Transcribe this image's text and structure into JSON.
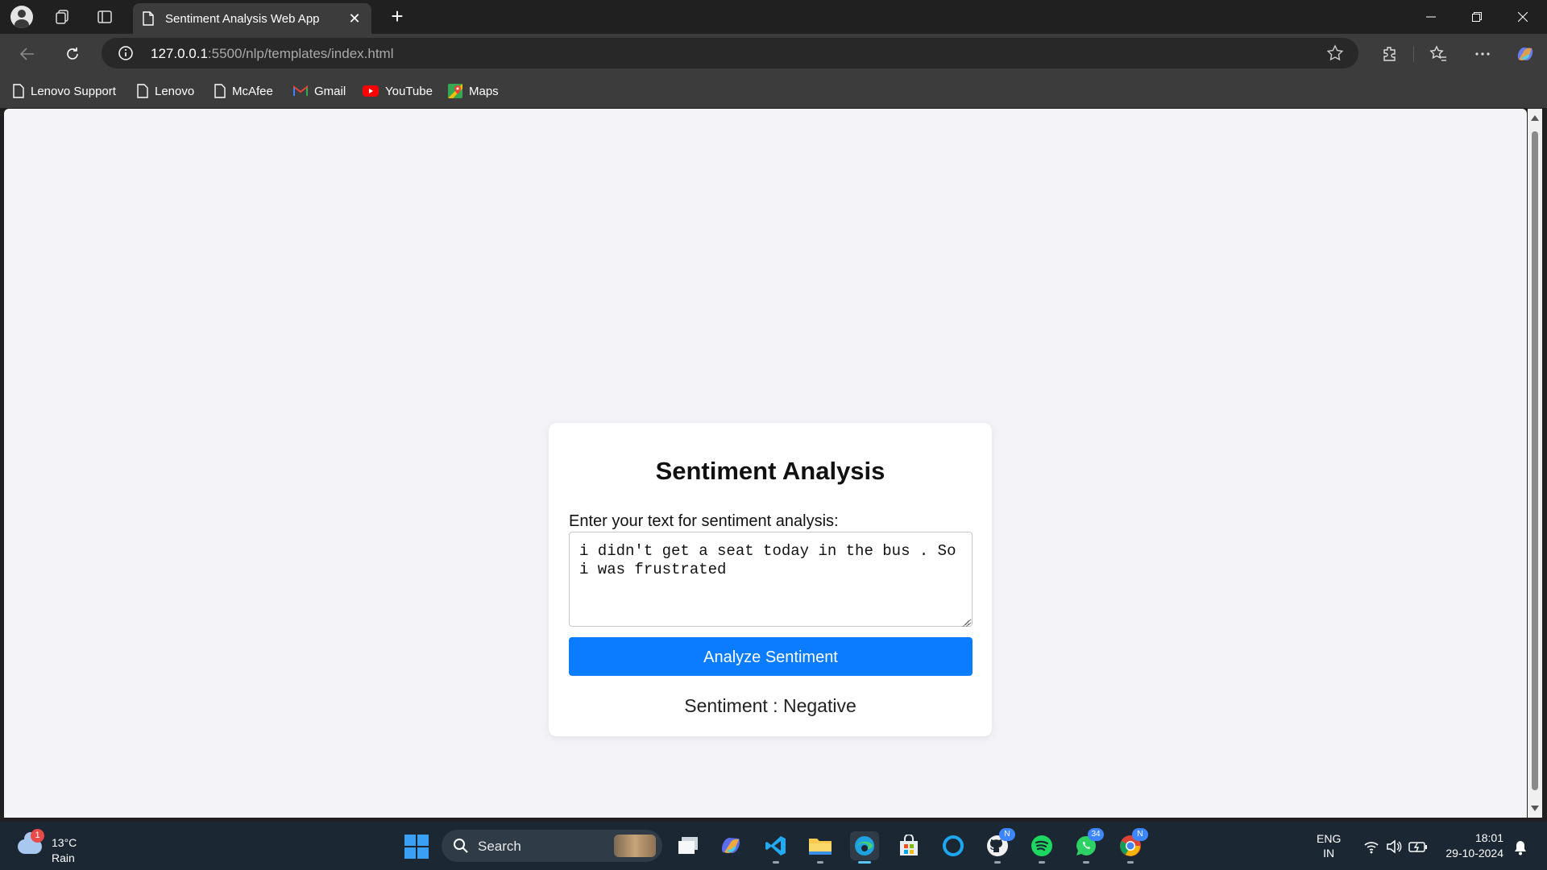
{
  "browser": {
    "tab_title": "Sentiment Analysis Web App",
    "url_host": "127.0.0.1",
    "url_rest": ":5500/nlp/templates/index.html"
  },
  "bookmarks": [
    {
      "label": "Lenovo Support",
      "icon": "page-icon"
    },
    {
      "label": "Lenovo",
      "icon": "page-icon"
    },
    {
      "label": "McAfee",
      "icon": "page-icon"
    },
    {
      "label": "Gmail",
      "icon": "gmail-icon"
    },
    {
      "label": "YouTube",
      "icon": "youtube-icon"
    },
    {
      "label": "Maps",
      "icon": "maps-icon"
    }
  ],
  "app": {
    "title": "Sentiment Analysis",
    "input_label": "Enter your text for sentiment analysis:",
    "input_value": "i didn't get a seat today in the bus . So i was frustrated",
    "button_label": "Analyze Sentiment",
    "result": "Sentiment : Negative"
  },
  "colors": {
    "button": "#0a7cff",
    "page_background": "#f4f4f8",
    "card_background": "#ffffff"
  },
  "taskbar": {
    "weather_badge": "1",
    "temperature": "13°C",
    "condition": "Rain",
    "search_label": "Search",
    "whatsapp_badge": "34",
    "github_badge": "N",
    "chrome_badge": "N",
    "lang_line1": "ENG",
    "lang_line2": "IN",
    "time": "18:01",
    "date": "29-10-2024"
  }
}
